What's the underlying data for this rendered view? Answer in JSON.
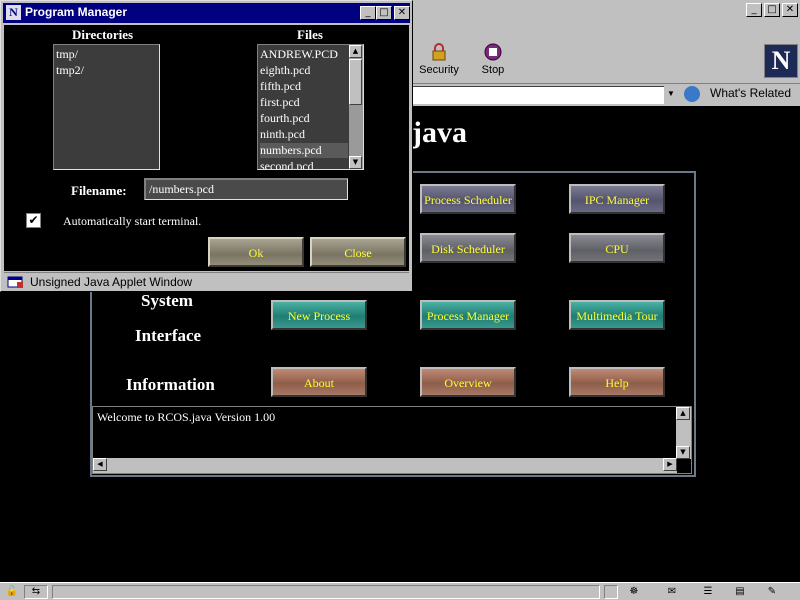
{
  "browser": {
    "toolbar": {
      "security_label": "Security",
      "stop_label": "Stop"
    },
    "location": {
      "url": "",
      "whats_related_label": "What's Related"
    },
    "window_controls": [
      "_",
      "□",
      "✕"
    ]
  },
  "page": {
    "heading": "java",
    "panel": {
      "row_labels": {
        "system": "System",
        "interface": "Interface",
        "information": "Information"
      },
      "buttons": {
        "process_scheduler": "Process Scheduler",
        "ipc_manager": "IPC Manager",
        "disk_scheduler": "Disk Scheduler",
        "cpu": "CPU",
        "new_process": "New Process",
        "process_manager": "Process Manager",
        "multimedia_tour": "Multimedia Tour",
        "about": "About",
        "overview": "Overview",
        "help": "Help"
      },
      "console_text": "Welcome to RCOS.java Version 1.00"
    }
  },
  "program_manager": {
    "title": "Program Manager",
    "title_icon": "N",
    "window_controls": [
      "_",
      "□",
      "✕"
    ],
    "directories_label": "Directories",
    "files_label": "Files",
    "directories": [
      "tmp/",
      "tmp2/"
    ],
    "files": [
      "ANDREW.PCD",
      "eighth.pcd",
      "fifth.pcd",
      "first.pcd",
      "fourth.pcd",
      "ninth.pcd",
      "numbers.pcd",
      "second.pcd"
    ],
    "selected_file": "numbers.pcd",
    "filename_label": "Filename:",
    "filename_value": "/numbers.pcd",
    "auto_start_label": "Automatically start terminal.",
    "auto_start_checked": true,
    "ok_label": "Ok",
    "close_label": "Close",
    "status_text": "Unsigned Java Applet Window"
  },
  "colors": {
    "title_bar": "#000080",
    "button_text": "#ffff33",
    "background": "#000000"
  }
}
